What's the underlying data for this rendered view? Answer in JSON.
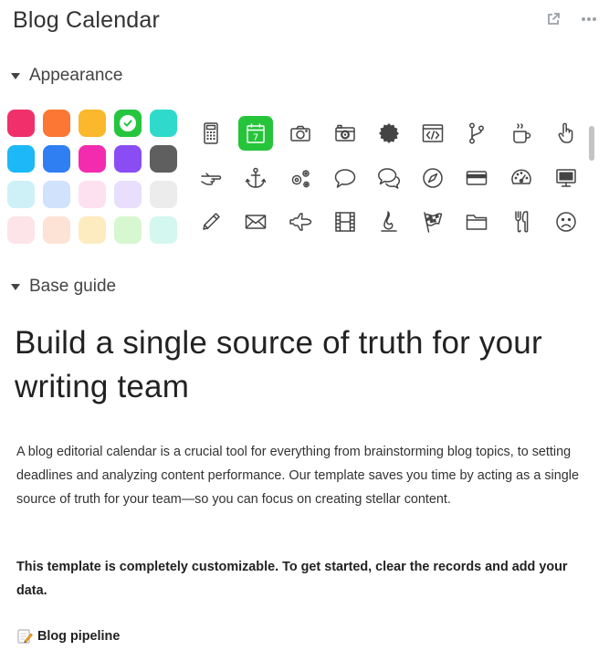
{
  "header": {
    "title": "Blog Calendar",
    "expand_icon": "external-link-icon",
    "more_icon": "more-icon"
  },
  "appearance": {
    "label": "Appearance",
    "colors": [
      "#f0306a",
      "#fb7733",
      "#fbb82c",
      "#25c53e",
      "#2fdacd",
      "#1cb8f7",
      "#2f7ff2",
      "#f22baf",
      "#8a4df4",
      "#5f5f5f",
      "#cdf1f6",
      "#d1e2fc",
      "#fde1f0",
      "#e9defc",
      "#ececec",
      "#fde4e8",
      "#fde2d6",
      "#fdecbf",
      "#d6f7cf",
      "#d4f7ef"
    ],
    "selected_color": "#25c53e",
    "icons": [
      "calculator",
      "calendar",
      "camera",
      "camera-retro",
      "badge",
      "code",
      "branch",
      "coffee",
      "hand-pointer",
      "hand-point-right",
      "anchor",
      "cogs",
      "chat-bubble",
      "chat-bubbles",
      "compass",
      "credit-card",
      "dashboard",
      "desktop",
      "pencil",
      "envelope",
      "fighter-jet",
      "film",
      "fire",
      "checkered-flag",
      "folder",
      "cutlery",
      "frown"
    ],
    "selected_icon": "calendar",
    "calendar_day": "7"
  },
  "base_guide": {
    "label": "Base guide",
    "heading": "Build a single source of truth for your writing team",
    "paragraph": "A blog editorial calendar is a crucial tool for everything from brainstorming blog topics, to setting deadlines and analyzing content performance. Our template saves you time by acting as a single source of truth for your team—so you can focus on creating stellar content.",
    "bold_paragraph": "This template is completely customizable. To get started, clear the records and add your data.",
    "pipeline_link": "Blog pipeline"
  }
}
